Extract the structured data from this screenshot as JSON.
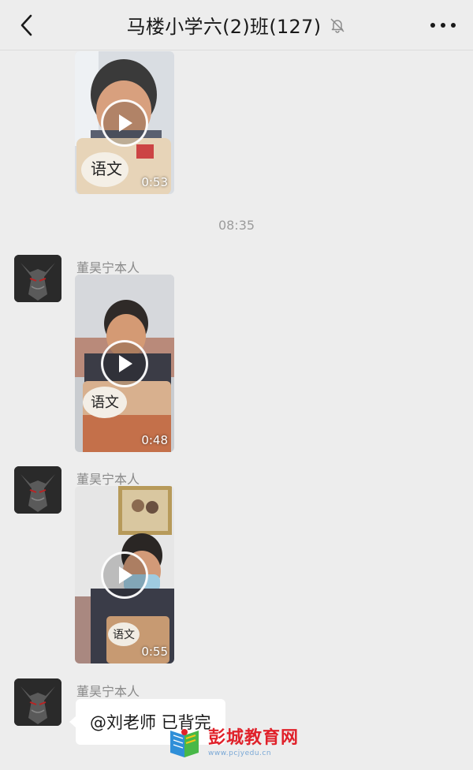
{
  "header": {
    "title": "马楼小学六(2)班(127)",
    "back_icon": "chevron-left-icon",
    "mute_icon": "bell-muted-icon",
    "more_icon": "ellipsis-icon"
  },
  "messages": [
    {
      "type": "video",
      "duration": "0:53"
    },
    {
      "type": "time",
      "text": "08:35"
    },
    {
      "type": "video",
      "sender": "董昊宁本人",
      "duration": "0:48"
    },
    {
      "type": "video",
      "sender": "董昊宁本人",
      "duration": "0:55"
    },
    {
      "type": "text",
      "sender": "董昊宁本人",
      "text": "@刘老师  已背完"
    }
  ],
  "watermark": {
    "name": "彭城教育网",
    "url": "www.pcjyedu.cn"
  },
  "colors": {
    "background": "#ededed",
    "bubble": "#ffffff",
    "watermark_red": "#e0212a"
  }
}
